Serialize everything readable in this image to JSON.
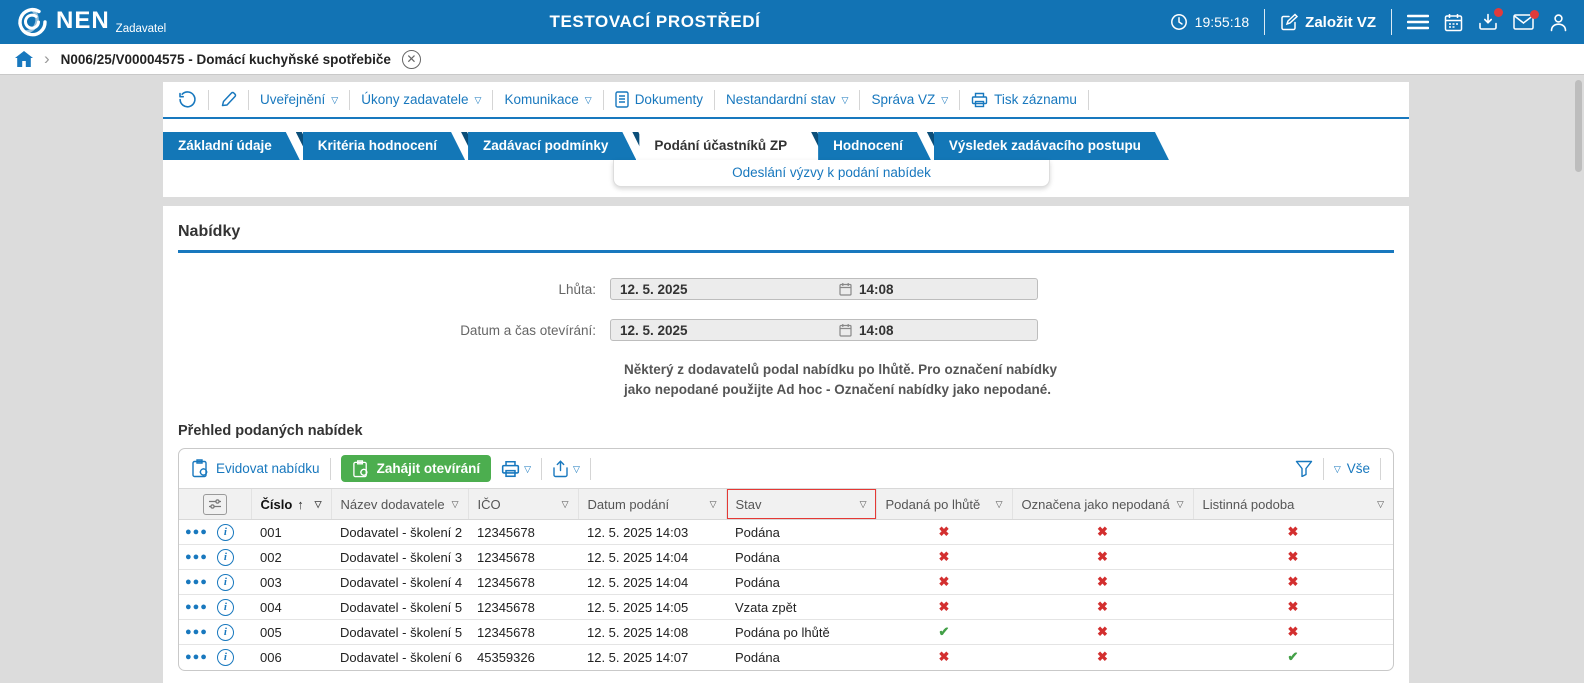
{
  "icons": {
    "caret_down": "▽",
    "sort_asc": "↑",
    "check": "✔",
    "cross": "✖",
    "chevron_right": "›",
    "dots": "●●●",
    "info": "i",
    "close": "✕"
  },
  "header": {
    "brand": "NEN",
    "brand_subtitle": "Zadavatel",
    "environment": "TESTOVACÍ PROSTŘEDÍ",
    "time": "19:55:18",
    "create_button": "Založit VZ"
  },
  "breadcrumb": {
    "record_title": "N006/25/V00004575 - Domácí kuchyňské spotřebiče"
  },
  "record_toolbar": {
    "items": [
      {
        "label": "Uveřejnění"
      },
      {
        "label": "Úkony zadavatele"
      },
      {
        "label": "Komunikace"
      },
      {
        "label": "Dokumenty"
      },
      {
        "label": "Nestandardní stav"
      },
      {
        "label": "Správa VZ"
      },
      {
        "label": "Tisk záznamu"
      }
    ]
  },
  "tabs": {
    "items": [
      {
        "label": "Základní údaje"
      },
      {
        "label": "Kritéria hodnocení"
      },
      {
        "label": "Zadávací podmínky"
      },
      {
        "label": "Podání účastníků ZP"
      },
      {
        "label": "Hodnocení"
      },
      {
        "label": "Výsledek zadávacího postupu"
      }
    ],
    "active_tab": "Podání účastníků ZP",
    "submenu_link": "Odeslání výzvy k podání nabídek"
  },
  "offers": {
    "section_title": "Nabídky",
    "deadline_label": "Lhůta:",
    "deadline_date": "12. 5. 2025",
    "deadline_time": "14:08",
    "opening_label": "Datum a čas otevírání:",
    "opening_date": "12. 5. 2025",
    "opening_time": "14:08",
    "warning": "Některý z dodavatelů podal nabídku po lhůtě. Pro označení nabídky jako nepodané použijte Ad hoc - Označení nabídky jako nepodané."
  },
  "grid": {
    "title": "Přehled podaných nabídek",
    "toolbar": {
      "register_offer": "Evidovat nabídku",
      "start_opening": "Zahájit otevírání",
      "filter_all": "Vše"
    },
    "columns": {
      "number": "Číslo",
      "supplier": "Název dodavatele",
      "ico": "IČO",
      "submitted": "Datum podání",
      "status": "Stav",
      "late": "Podaná po lhůtě",
      "not_submitted": "Označena jako nepodaná",
      "paper": "Listinná podoba"
    },
    "rows": [
      {
        "number": "001",
        "supplier": "Dodavatel - školení 2",
        "ico": "12345678",
        "submitted": "12. 5. 2025 14:03",
        "status": "Podána",
        "late": "no",
        "not_submitted": "no",
        "paper": "no"
      },
      {
        "number": "002",
        "supplier": "Dodavatel - školení 3",
        "ico": "12345678",
        "submitted": "12. 5. 2025 14:04",
        "status": "Podána",
        "late": "no",
        "not_submitted": "no",
        "paper": "no"
      },
      {
        "number": "003",
        "supplier": "Dodavatel - školení 4",
        "ico": "12345678",
        "submitted": "12. 5. 2025 14:04",
        "status": "Podána",
        "late": "no",
        "not_submitted": "no",
        "paper": "no"
      },
      {
        "number": "004",
        "supplier": "Dodavatel - školení 5",
        "ico": "12345678",
        "submitted": "12. 5. 2025 14:05",
        "status": "Vzata zpět",
        "late": "no",
        "not_submitted": "no",
        "paper": "no"
      },
      {
        "number": "005",
        "supplier": "Dodavatel - školení 5",
        "ico": "12345678",
        "submitted": "12. 5. 2025 14:08",
        "status": "Podána po lhůtě",
        "late": "yes",
        "not_submitted": "no",
        "paper": "no"
      },
      {
        "number": "006",
        "supplier": "Dodavatel - školení 6",
        "ico": "45359326",
        "submitted": "12. 5. 2025 14:07",
        "status": "Podána",
        "late": "no",
        "not_submitted": "no",
        "paper": "yes"
      }
    ]
  },
  "colors": {
    "header_bg": "#1273b4",
    "accent": "#1878be",
    "green_button": "#4cae4f",
    "red_mark": "#d32f2f",
    "green_mark": "#43a047",
    "highlight_border": "#e53935"
  }
}
